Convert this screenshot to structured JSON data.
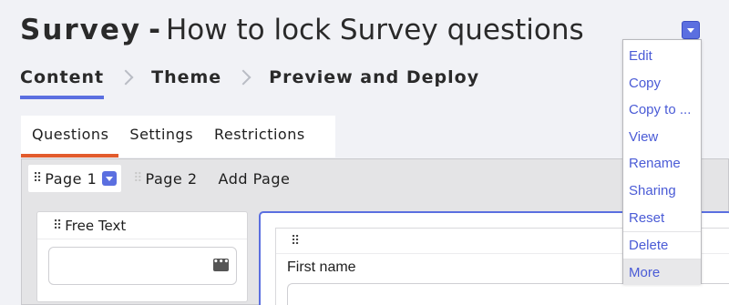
{
  "header": {
    "title_prefix": "Survey",
    "title_separator": "-",
    "title_name": "How to lock Survey questions"
  },
  "steps": [
    {
      "label": "Content",
      "active": true
    },
    {
      "label": "Theme",
      "active": false
    },
    {
      "label": "Preview and Deploy",
      "active": false
    }
  ],
  "tabs": [
    {
      "label": "Questions",
      "active": true
    },
    {
      "label": "Settings",
      "active": false
    },
    {
      "label": "Restrictions",
      "active": false
    }
  ],
  "pages": {
    "items": [
      "Page 1",
      "Page 2"
    ],
    "add_label": "Add Page"
  },
  "palette": {
    "item_label": "Free Text",
    "icon": "more-dots-icon"
  },
  "question": {
    "label": "First name"
  },
  "menu": {
    "items": [
      "Edit",
      "Copy",
      "Copy to ...",
      "View",
      "Rename",
      "Sharing",
      "Reset",
      "Delete",
      "More"
    ],
    "highlighted": "More"
  },
  "colors": {
    "accent": "#5b6fe0",
    "tab_underline": "#e25b2c",
    "link": "#4a5bd6",
    "background": "#f1f2f6"
  }
}
